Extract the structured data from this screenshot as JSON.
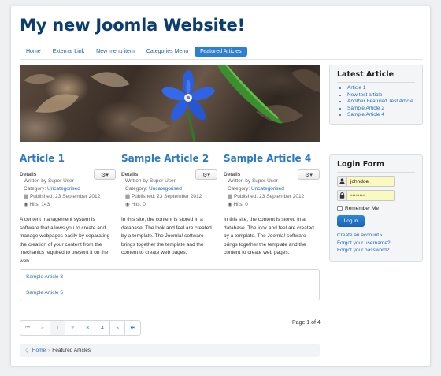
{
  "site": {
    "title": "My new Joomla Website!"
  },
  "nav": {
    "items": [
      {
        "label": "Home"
      },
      {
        "label": "External Link"
      },
      {
        "label": "New menu item"
      },
      {
        "label": "Categories Menu"
      },
      {
        "label": "Featured Articles",
        "active": true
      }
    ]
  },
  "articles": [
    {
      "title": "Article 1",
      "details_label": "Details",
      "author": "Written by Super User",
      "category_prefix": "Category: ",
      "category": "Uncategorised",
      "published": "Published: 23 September 2012",
      "hits": "Hits: 143",
      "body": "A content management system is software that allows you to create and manage webpages easily by separating the creation of your content from the mechanics required to present it on the web."
    },
    {
      "title": "Sample Article 2",
      "details_label": "Details",
      "author": "Written by Super User",
      "category_prefix": "Category: ",
      "category": "Uncategorised",
      "published": "Published: 23 September 2012",
      "hits": "Hits: 0",
      "body": "In this site, the content is stored in a database. The look and feel are created by a template. The Joomla! software brings together the template and the content to create web pages."
    },
    {
      "title": "Sample Article 4",
      "details_label": "Details",
      "author": "Written by Super User",
      "category_prefix": "Category: ",
      "category": "Uncategorised",
      "published": "Published: 23 September 2012",
      "hits": "Hits: 0",
      "body": "In this site, the content is stored in a database. The look and feel are created by a template. The Joomla! software brings together the template and the content to create web pages."
    }
  ],
  "more_articles": [
    "Sample Article 3",
    "Sample Article 5"
  ],
  "pagination": {
    "start": "⏮",
    "prev": "«",
    "pages": [
      "1",
      "2",
      "3",
      "4"
    ],
    "current": "1",
    "next": "»",
    "end": "⏭",
    "counter": "Page 1 of 4"
  },
  "breadcrumb": {
    "home": "Home",
    "separator": "›",
    "current": "Featured Articles"
  },
  "latest": {
    "title": "Latest Article",
    "items": [
      "Article 1",
      "New test article",
      "Another Featured Test Article",
      "Sample Article 2",
      "Sample Article 4"
    ]
  },
  "login": {
    "title": "Login Form",
    "username": "johndoe",
    "password": "••••••••",
    "remember_label": "Remember Me",
    "button_label": "Log in",
    "create_account": "Create an account",
    "forgot_username": "Forgot your username?",
    "forgot_password": "Forgot your password?"
  },
  "colors": {
    "title": "#0b3d6e",
    "link": "#1e6ac0",
    "active_tab": "#2d7fd1",
    "flower": "#2a5de0"
  },
  "icons": {
    "gear": "gear-icon",
    "user": "user-icon",
    "lock": "lock-icon",
    "calendar": "calendar-icon",
    "eye": "eye-icon",
    "map_marker": "map-marker-icon"
  }
}
